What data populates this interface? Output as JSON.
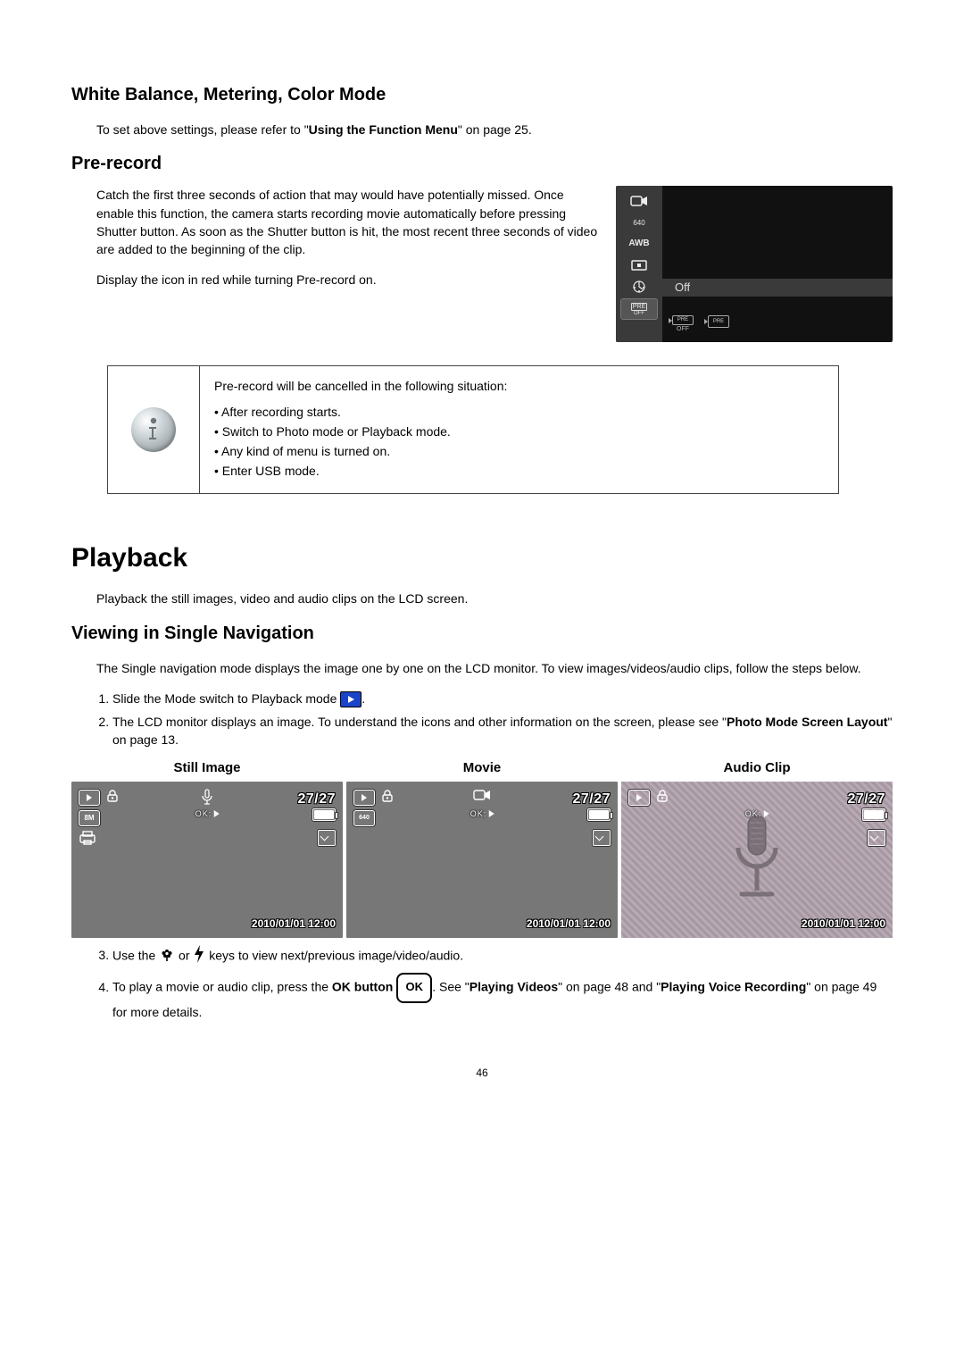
{
  "sections": {
    "wb_heading": "White Balance, Metering, Color Mode",
    "wb_text_a": "To set above settings, please refer to \"",
    "wb_text_b": "Using the Function Menu",
    "wb_text_c": "\" on page 25.",
    "pre_heading": "Pre-record",
    "pre_para": "Catch the first three seconds of action that may would have potentially missed. Once enable this function, the camera starts recording movie automatically before pressing Shutter button. As soon as the Shutter button is hit, the most recent three seconds of video are added to the beginning of the clip.",
    "pre_icon_note": "Display the icon in red while turning Pre-record on.",
    "playback_heading": "Playback",
    "playback_intro": "Playback the still images, video and audio clips on the LCD screen.",
    "single_heading": "Viewing in Single Navigation",
    "single_para": "The Single navigation mode displays the image one by one on the LCD monitor. To view images/videos/audio clips, follow the steps below."
  },
  "cam_menu": {
    "sidebar": {
      "item_640": "640",
      "item_awb": "AWB",
      "item_pre_off": "OFF",
      "item_pre": "PRE"
    },
    "selected_label": "Off",
    "thumb_off": "OFF",
    "thumb_pre": "PRE"
  },
  "note": {
    "lead": "Pre-record will be cancelled in the following situation:",
    "items": [
      "After recording starts.",
      "Switch to Photo mode or Playback mode.",
      "Any kind of menu is turned on.",
      "Enter USB mode."
    ]
  },
  "steps": {
    "s1_a": "Slide the Mode switch to Playback mode ",
    "s1_b": ".",
    "s2_a": "The LCD monitor displays an image. To understand the icons and other information on the screen, please see \"",
    "s2_b": "Photo Mode Screen Layout",
    "s2_c": "\" on page 13.",
    "s3_a": "Use the ",
    "s3_b": " or ",
    "s3_c": " keys to view next/previous image/video/audio.",
    "s4_a": "To play a movie or audio clip, press the ",
    "s4_b": "OK button",
    "s4_c": ". See \"",
    "s4_d": "Playing Videos",
    "s4_e": "\" on page 48 and \"",
    "s4_f": "Playing Voice Recording",
    "s4_g": "\" on page 49 for more details."
  },
  "previews": {
    "still_title": "Still Image",
    "movie_title": "Movie",
    "audio_title": "Audio Clip",
    "counter": "27/27",
    "timestamp": "2010/01/01 12:00",
    "ok_label": "OK:",
    "res_8m": "8M",
    "res_640": "640"
  },
  "ok_button_text": "OK",
  "page_number": "46"
}
